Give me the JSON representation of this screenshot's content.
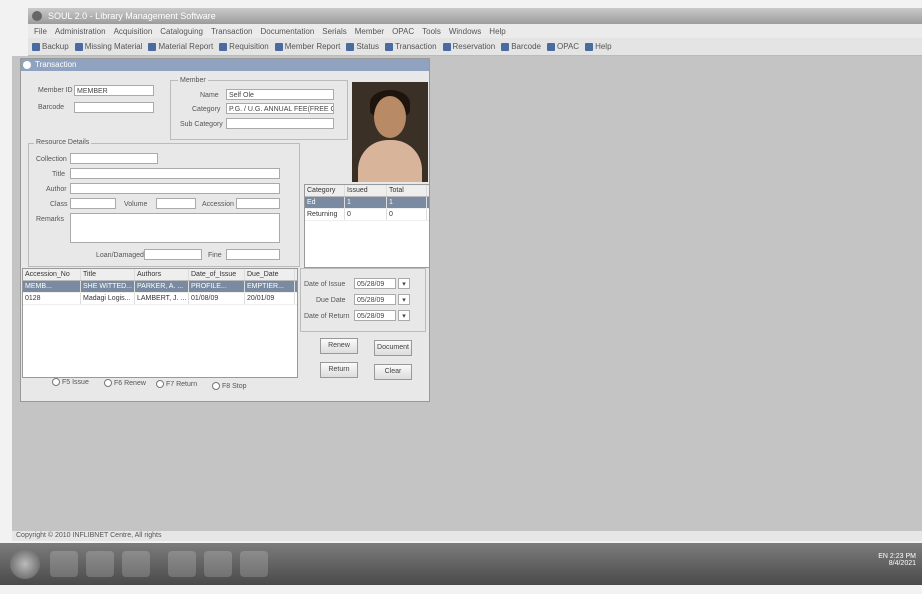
{
  "window": {
    "title": "SOUL 2.0 - Library Management Software"
  },
  "menu": [
    "File",
    "Administration",
    "Acquisition",
    "Cataloguing",
    "Transaction",
    "Documentation",
    "Serials",
    "Member",
    "OPAC",
    "Tools",
    "Windows",
    "Help"
  ],
  "toolbar": [
    "Backup",
    "Missing Material",
    "Material Report",
    "Requisition",
    "Member Report",
    "Status",
    "Transaction",
    "Reservation",
    "Barcode",
    "OPAC",
    "Help"
  ],
  "child": {
    "title": "Transaction"
  },
  "member": {
    "member_id_label": "Member ID",
    "member_id_value": "MEMBER",
    "barcode_label": "Barcode",
    "group_title": "Member",
    "name_label": "Name",
    "name_value": "Self Ole",
    "category_label": "Category",
    "category_value": "P.G. / U.G. ANNUAL FEE(FREE CARD)",
    "subcategory_label": "Sub Category"
  },
  "resource": {
    "group_title": "Resource Details",
    "collection_label": "Collection",
    "title_label": "Title",
    "author_label": "Author",
    "class_label": "Class",
    "volume_label": "Volume",
    "accession_label": "Accession No",
    "remarks_label": "Remarks",
    "loan_label": "Loan/Damaged",
    "fine_label": "Fine"
  },
  "summary": {
    "headers": [
      "Category",
      "Issued",
      "Total"
    ],
    "rows": [
      [
        "Ed",
        "1",
        "1"
      ],
      [
        "Returning",
        "0",
        "0"
      ]
    ]
  },
  "loans": {
    "headers": [
      "Accession_No",
      "Title",
      "Authors",
      "Date_of_Issue",
      "Due_Date"
    ],
    "rows": [
      [
        "MEMB...",
        "SHE WITTED...",
        "PARKER, A. ...",
        "PROFILE...",
        "EMPTIER..."
      ],
      [
        "0128",
        "Madagi Logis...",
        "LAMBERT, J. ...",
        "01/08/09",
        "20/01/09"
      ]
    ]
  },
  "dates": {
    "issue_label": "Date of Issue",
    "issue_value": "05/28/09",
    "due_label": "Due Date",
    "due_value": "05/28/09",
    "return_label": "Date of Return",
    "return_value": "05/28/09"
  },
  "buttons": {
    "renew": "Renew",
    "document": "Document",
    "return": "Return",
    "clear": "Clear"
  },
  "modes": [
    "F5 Issue",
    "F6 Renew",
    "F7 Return",
    "F8 Stop"
  ],
  "status": {
    "text": "Copyright © 2010 INFLIBNET Centre, All rights"
  },
  "tray": {
    "lang": "EN",
    "time": "2:23 PM",
    "date": "8/4/2021"
  }
}
